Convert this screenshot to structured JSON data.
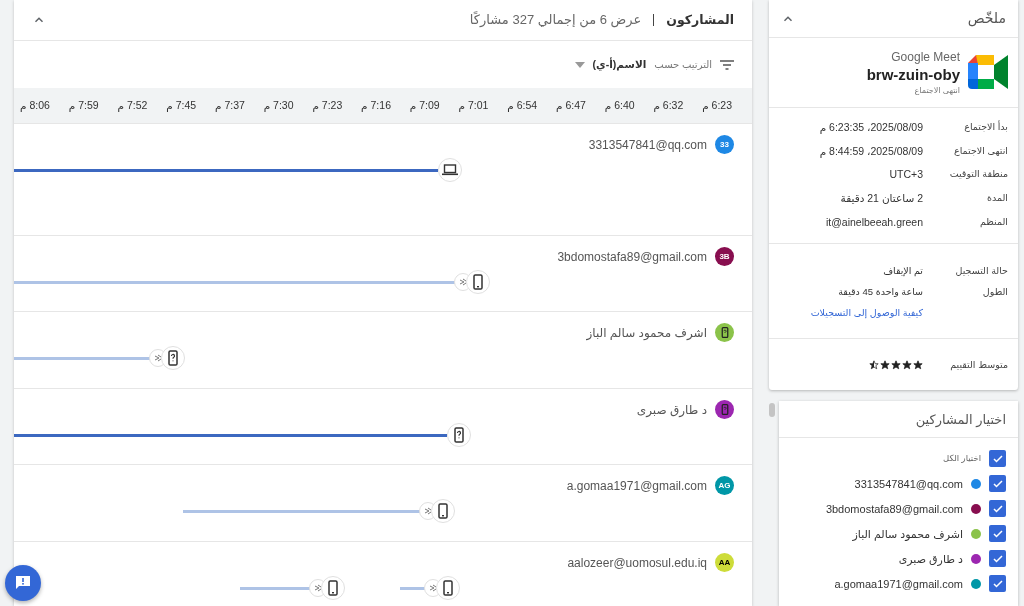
{
  "participants_panel": {
    "title": "المشاركون",
    "subtitle": "عرض 6 من إجمالي 327 مشاركًا",
    "expanded": true,
    "sort_label": "الترتيب حسب",
    "sort_value": "الاسم(أ-ي)",
    "ticks": [
      "6:23 م",
      "6:32 م",
      "6:40 م",
      "6:47 م",
      "6:54 م",
      "7:01 م",
      "7:09 م",
      "7:16 م",
      "7:23 م",
      "7:30 م",
      "7:37 م",
      "7:45 م",
      "7:52 م",
      "7:59 م",
      "8:06 م"
    ],
    "rows": [
      {
        "avatar": {
          "kind": "initials",
          "text": "33"
        },
        "name": "3313547841@qq.com",
        "color": "#1e88e5",
        "highlighted": true,
        "segments": [
          {
            "kind": "laptop",
            "signal": false
          }
        ]
      },
      {
        "avatar": {
          "kind": "initials",
          "text": "3B"
        },
        "name": "3bdomostafa89@gmail.com",
        "color": "#880e4f",
        "highlighted": false,
        "segments": [
          {
            "kind": "phone",
            "signal": true
          }
        ]
      },
      {
        "avatar": {
          "kind": "device"
        },
        "name": "اشرف محمود سالم الباز",
        "color": "#8bc34a",
        "highlighted": false,
        "segments": [
          {
            "kind": "unknown",
            "signal": true
          }
        ]
      },
      {
        "avatar": {
          "kind": "device"
        },
        "name": "د طارق صبرى",
        "color": "#9c27b0",
        "highlighted": true,
        "segments": [
          {
            "kind": "unknown",
            "signal": false
          }
        ]
      },
      {
        "avatar": {
          "kind": "initials",
          "text": "AG"
        },
        "name": "a.gomaa1971@gmail.com",
        "color": "#0097a7",
        "highlighted": false,
        "segments": [
          {
            "kind": "phone",
            "signal": true
          }
        ]
      },
      {
        "avatar": {
          "kind": "initials",
          "text": "AA"
        },
        "name": "aalozeer@uomosul.edu.iq",
        "color": "#cddc39",
        "highlighted": false,
        "segments": [
          {
            "kind": "phone",
            "signal": true
          },
          {
            "kind": "phone",
            "signal": true
          }
        ]
      }
    ]
  },
  "summary": {
    "title": "ملخّص",
    "expanded": true,
    "app": "Google Meet",
    "code": "brw-zuin-oby",
    "status": "انتهى الاجتماع",
    "details": [
      {
        "label": "بدأ الاجتماع",
        "value": "2025/08/09، 6:23:35 م"
      },
      {
        "label": "انتهى الاجتماع",
        "value": "2025/08/09، 8:44:59 م"
      },
      {
        "label": "منطقة التوقيت",
        "value": "UTC+3"
      },
      {
        "label": "المدة",
        "value": "2 ساعتان 21 دقيقة"
      },
      {
        "label": "المنظم",
        "value": "it@ainelbeeah.green"
      }
    ],
    "recording": [
      {
        "label": "حالة التسجيل",
        "value": "تم الإيقاف"
      },
      {
        "label": "الطول",
        "value": "ساعة واحدة 45 دقيقة"
      }
    ],
    "recording_link": "كيفية الوصول إلى التسجيلات",
    "rating_label": "متوسط التقييم",
    "stars": 4.5
  },
  "selection": {
    "title": "اختيار المشاركين",
    "select_all": {
      "label": "اختيار الكل",
      "checked": true
    },
    "items": [
      {
        "name": "3313547841@qq.com",
        "color": "#1e88e5",
        "checked": true
      },
      {
        "name": "3bdomostafa89@gmail.com",
        "color": "#880e4f",
        "checked": true
      },
      {
        "name": "اشرف محمود سالم الباز",
        "color": "#8bc34a",
        "checked": true
      },
      {
        "name": "د طارق صبرى",
        "color": "#9c27b0",
        "checked": true
      },
      {
        "name": "a.gomaa1971@gmail.com",
        "color": "#0097a7",
        "checked": true
      }
    ]
  }
}
